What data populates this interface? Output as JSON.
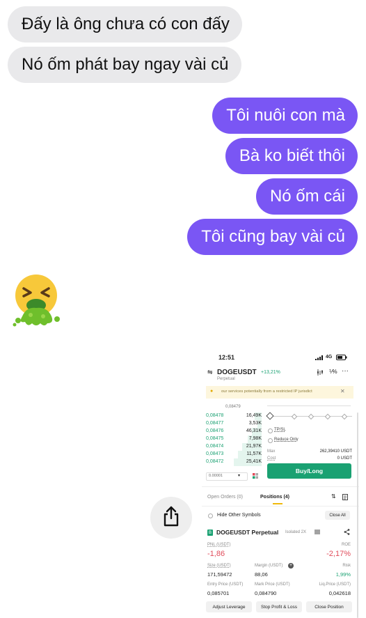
{
  "messages": {
    "received": [
      "Đấy là ông chưa có con đấy",
      "Nó ốm phát bay ngay vài củ"
    ],
    "sent": [
      "Tôi nuôi con mà",
      "Bà ko biết thôi",
      "Nó ốm cái",
      "Tôi cũng bay vài củ"
    ]
  },
  "emoji": {
    "name": "vomiting-face-emoji"
  },
  "colors": {
    "received_bubble": "#e9e9eb",
    "sent_bubble": "#7a56f4",
    "trade_green": "#1aa172",
    "trade_red": "#e04b5a"
  },
  "screenshot": {
    "status": {
      "time": "12:51",
      "network": "4G"
    },
    "pair": {
      "symbol": "DOGEUSDT",
      "change": "+13,21%",
      "type": "Perpetual"
    },
    "notice": "our services potentially from a restricted IP jurisdict",
    "orderbook": {
      "top_price": "0,08479",
      "rows": [
        {
          "price": "0,08478",
          "qty": "16,49K"
        },
        {
          "price": "0,08477",
          "qty": "3,53K"
        },
        {
          "price": "0,08476",
          "qty": "46,31K"
        },
        {
          "price": "0,08475",
          "qty": "7,98K"
        },
        {
          "price": "0,08474",
          "qty": "21,97K"
        },
        {
          "price": "0,08473",
          "qty": "11,57K"
        },
        {
          "price": "0,08472",
          "qty": "25,41K"
        }
      ],
      "tick": "0.00001"
    },
    "order_form": {
      "tpsl": "TP/SL",
      "reduce_only": "Reduce Only",
      "max_label": "Max",
      "max_value": "262,39410 USDT",
      "cost_label": "Cost",
      "cost_value": "0 USDT",
      "buy_button": "Buy/Long"
    },
    "tabs": {
      "open_orders": "Open Orders (0)",
      "positions": "Positions (4)"
    },
    "hide_other": "Hide Other Symbols",
    "close_all": "Close All",
    "position": {
      "symbol": "DOGEUSDT Perpetual",
      "mode": "Isolated 2X",
      "pnl_label": "PNL (USDT)",
      "pnl_value": "-1,86",
      "roe_label": "ROE",
      "roe_value": "-2,17%",
      "size_label": "Size (USDT)",
      "size_value": "171,59472",
      "margin_label": "Margin (USDT)",
      "margin_value": "88,06",
      "risk_label": "Risk",
      "risk_value": "1,99%",
      "entry_label": "Entry Price (USDT)",
      "entry_value": "0,085701",
      "mark_label": "Mark Price (USDT)",
      "mark_value": "0,084790",
      "liq_label": "Liq.Price (USDT)",
      "liq_value": "0,042618"
    },
    "actions": {
      "adjust": "Adjust Leverage",
      "stop": "Stop Profit & Loss",
      "close": "Close Position"
    }
  }
}
